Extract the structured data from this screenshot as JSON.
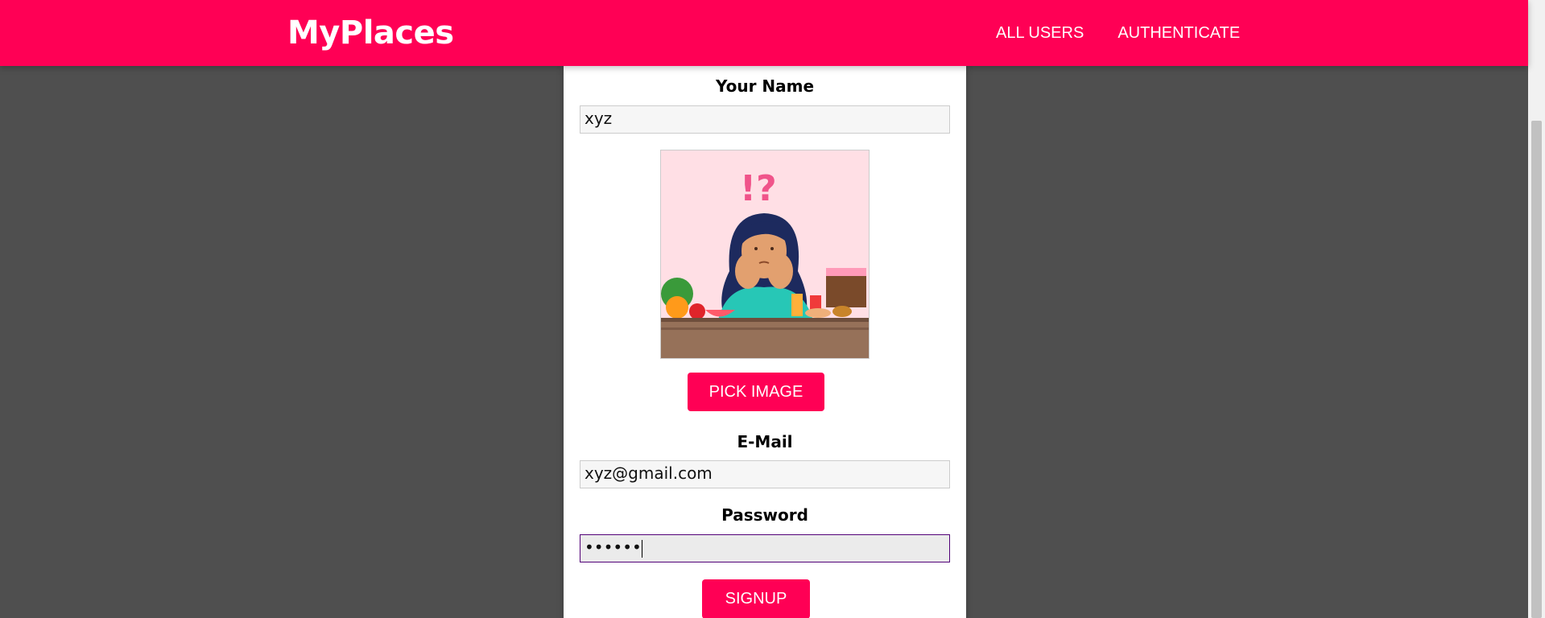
{
  "header": {
    "logo": "MyPlaces",
    "nav": {
      "all_users": "ALL USERS",
      "authenticate": "AUTHENTICATE"
    }
  },
  "form": {
    "name_label": "Your Name",
    "name_value": "xyz",
    "pick_image_label": "PICK IMAGE",
    "email_label": "E-Mail",
    "email_value": "xyz@gmail.com",
    "password_label": "Password",
    "password_value": "••••••",
    "signup_label": "SIGNUP"
  },
  "colors": {
    "brand": "#ff0055",
    "page_bg": "#4f4f4f",
    "focus_border": "#510077"
  },
  "preview_image": {
    "icon": "confused-girl-with-food-illustration",
    "glyphs": "!?"
  }
}
